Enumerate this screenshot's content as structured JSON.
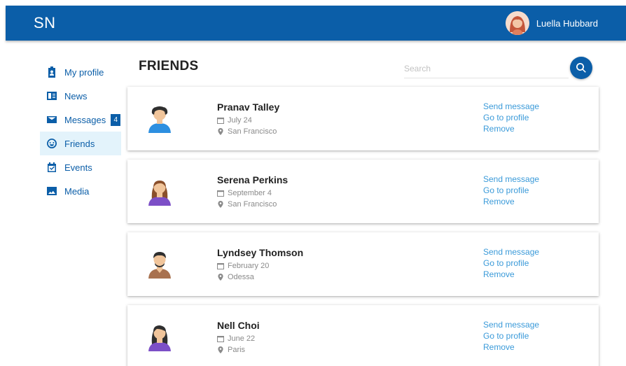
{
  "header": {
    "brand": "SN",
    "user_name": "Luella Hubbard"
  },
  "sidebar": {
    "items": [
      {
        "label": "My profile",
        "icon": "profile-badge-icon"
      },
      {
        "label": "News",
        "icon": "news-icon"
      },
      {
        "label": "Messages",
        "icon": "envelope-icon",
        "badge": "4"
      },
      {
        "label": "Friends",
        "icon": "smiley-icon",
        "active": true
      },
      {
        "label": "Events",
        "icon": "calendar-check-icon"
      },
      {
        "label": "Media",
        "icon": "image-icon"
      }
    ]
  },
  "main": {
    "title": "FRIENDS",
    "search": {
      "placeholder": "Search",
      "value": ""
    }
  },
  "friends": [
    {
      "name": "Pranav Talley",
      "date": "July 24",
      "city": "San Francisco",
      "avatar_color": "#2d8fe0"
    },
    {
      "name": "Serena Perkins",
      "date": "September 4",
      "city": "San Francisco",
      "avatar_color": "#7c4fc7"
    },
    {
      "name": "Lyndsey Thomson",
      "date": "February 20",
      "city": "Odessa",
      "avatar_color": "#a8714f"
    },
    {
      "name": "Nell Choi",
      "date": "June 22",
      "city": "Paris",
      "avatar_color": "#7c4fc7"
    }
  ],
  "actions": {
    "send_message": "Send message",
    "go_to_profile": "Go to profile",
    "remove": "Remove"
  },
  "colors": {
    "primary": "#0b5ea8",
    "link": "#3a9ad9",
    "active_bg": "#e3f3fb"
  }
}
